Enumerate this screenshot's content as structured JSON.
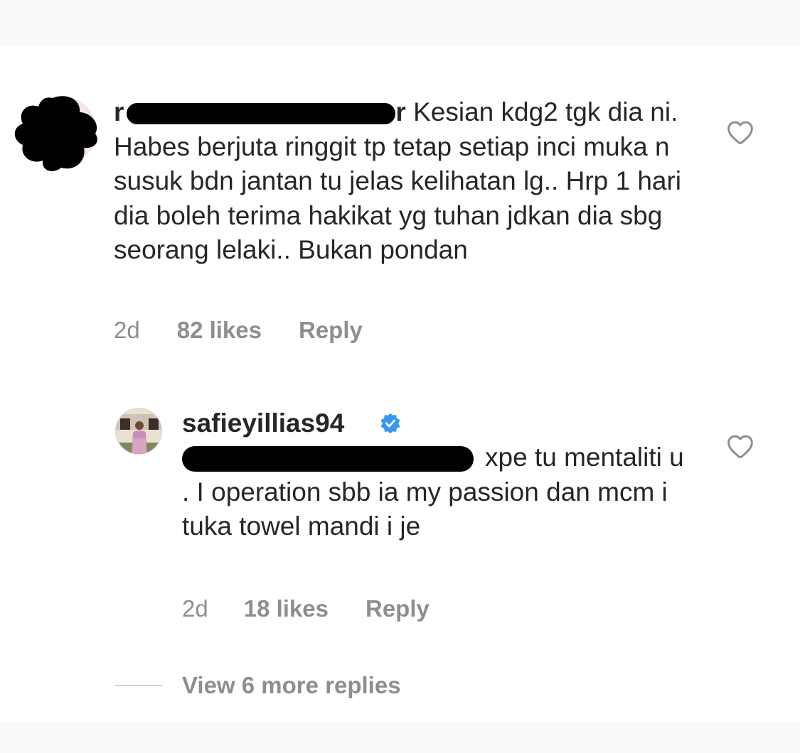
{
  "comments": [
    {
      "username_visible": "r",
      "username_tail": "r",
      "text": "Kesian kdg2 tgk dia ni. Habes berjuta ringgit tp tetap setiap inci muka n susuk bdn jantan tu jelas kelihatan lg.. Hrp 1 hari dia boleh terima hakikat yg tuhan jdkan dia sbg seorang lelaki.. Bukan pondan",
      "age": "2d",
      "likes": "82 likes",
      "reply": "Reply",
      "like_icon": "heart-outline-icon"
    },
    {
      "username": "safieyillias94",
      "verified_icon": "verified-badge-icon",
      "text": "xpe tu mentaliti u . I operation sbb ia my passion dan mcm i tuka towel mandi i je",
      "age": "2d",
      "likes": "18 likes",
      "reply": "Reply",
      "like_icon": "heart-outline-icon"
    }
  ],
  "view_more": "View 6 more replies",
  "colors": {
    "text": "#262626",
    "meta": "#8e8e8e",
    "verified": "#3897f0",
    "redaction": "#000000"
  }
}
